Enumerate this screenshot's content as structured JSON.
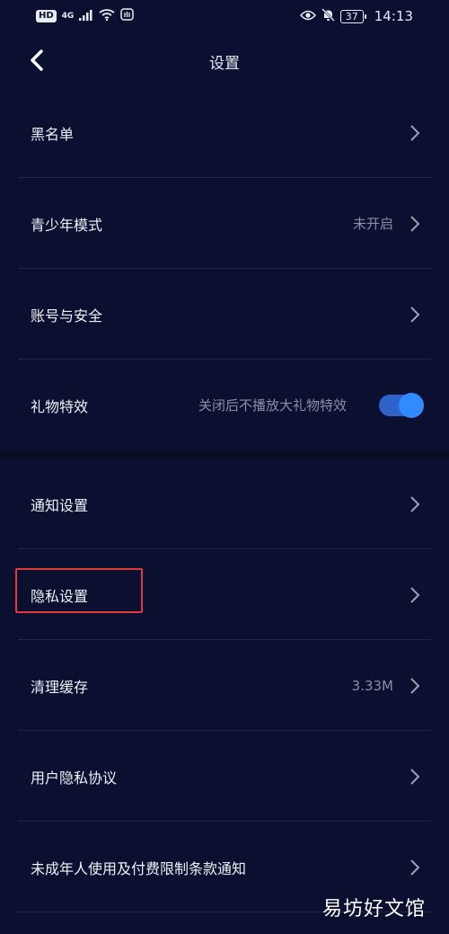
{
  "status_bar": {
    "network_badge": "HD",
    "network_type": "4G",
    "battery": "37",
    "time": "14:13"
  },
  "header": {
    "title": "设置"
  },
  "group1": [
    {
      "label": "黑名单",
      "value": ""
    },
    {
      "label": "青少年模式",
      "value": "未开启"
    },
    {
      "label": "账号与安全",
      "value": ""
    },
    {
      "label": "礼物特效",
      "value": "关闭后不播放大礼物特效",
      "toggle_on": true
    }
  ],
  "group2": [
    {
      "label": "通知设置",
      "value": ""
    },
    {
      "label": "隐私设置",
      "value": ""
    },
    {
      "label": "清理缓存",
      "value": "3.33M"
    },
    {
      "label": "用户隐私协议",
      "value": ""
    },
    {
      "label": "未成年人使用及付费限制条款通知",
      "value": ""
    }
  ],
  "watermark": "易坊好文馆",
  "colors": {
    "background": "#0b1030",
    "accent": "#2f8bff",
    "highlight": "#e23a3a"
  }
}
